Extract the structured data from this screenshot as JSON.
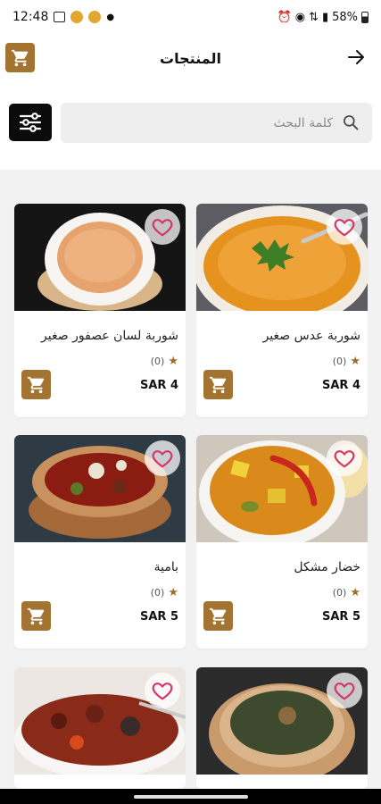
{
  "status_bar": {
    "time": "12:48",
    "battery": "58%"
  },
  "header": {
    "title": "المنتجات"
  },
  "search": {
    "placeholder": "كلمة البحث"
  },
  "colors": {
    "accent": "#a27331",
    "heart": "#d6336c",
    "star": "#9c6d2c"
  },
  "products": [
    {
      "name": "شوربة عدس صغير",
      "rating": "(0)",
      "price": "SAR 4",
      "image": "lentil-soup"
    },
    {
      "name": "شوربة لسان عصفور صغير",
      "rating": "(0)",
      "price": "SAR 4",
      "image": "orzo-soup"
    },
    {
      "name": "خضار مشكل",
      "rating": "(0)",
      "price": "SAR 5",
      "image": "mixed-vegetables"
    },
    {
      "name": "بامية",
      "rating": "(0)",
      "price": "SAR 5",
      "image": "okra-stew"
    },
    {
      "name": "",
      "rating": "",
      "price": "",
      "image": "molokhia"
    },
    {
      "name": "",
      "rating": "",
      "price": "",
      "image": "eggplant-stew"
    }
  ]
}
